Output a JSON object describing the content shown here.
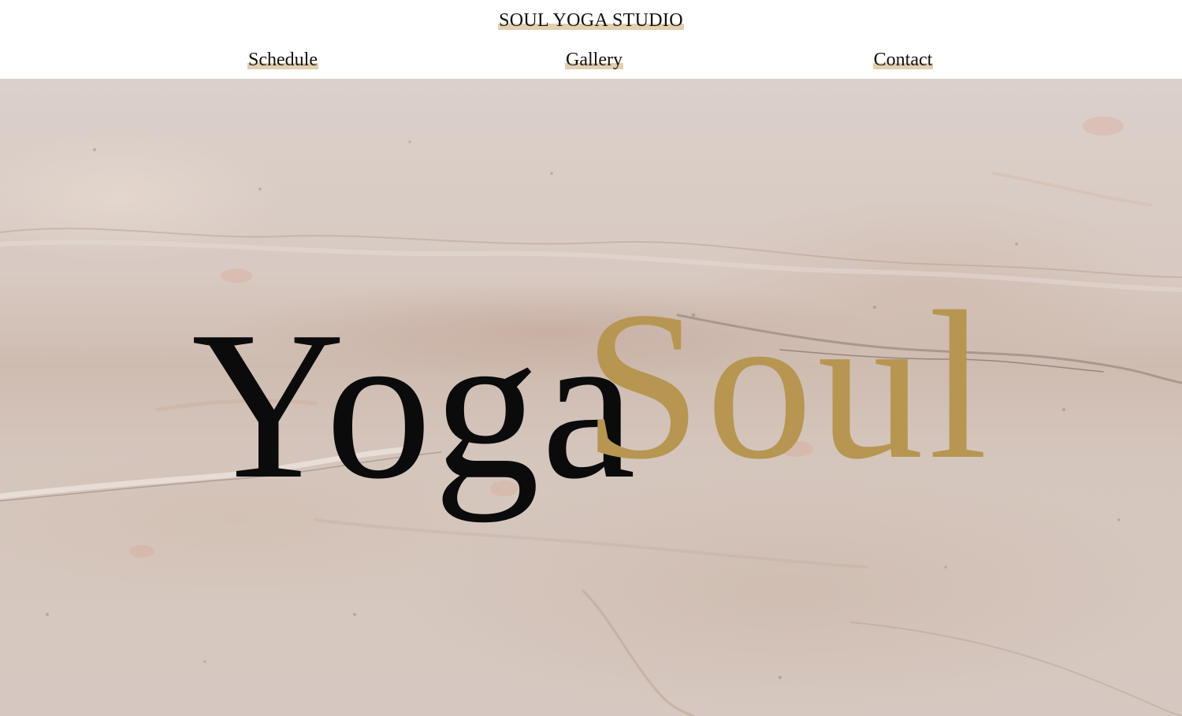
{
  "header": {
    "site_title": "SOUL YOGA STUDIO"
  },
  "nav": {
    "items": [
      {
        "label": "Schedule"
      },
      {
        "label": "Gallery"
      },
      {
        "label": "Contact"
      }
    ]
  },
  "hero": {
    "word_black": "Yoga",
    "word_gold": "Soul",
    "background": "marble-texture"
  },
  "colors": {
    "accent_gold": "#b69651",
    "link_highlight": "#e2cfb1",
    "text": "#111111"
  }
}
